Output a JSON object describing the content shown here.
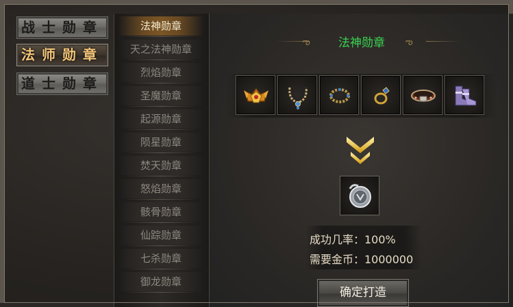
{
  "class_tabs": [
    {
      "label": "战士勋章",
      "active": false
    },
    {
      "label": "法师勋章",
      "active": true
    },
    {
      "label": "道士勋章",
      "active": false
    }
  ],
  "medal_list": [
    {
      "label": "法神勋章",
      "active": true
    },
    {
      "label": "天之法神勋章",
      "active": false
    },
    {
      "label": "烈焰勋章",
      "active": false
    },
    {
      "label": "圣魔勋章",
      "active": false
    },
    {
      "label": "起源勋章",
      "active": false
    },
    {
      "label": "陨星勋章",
      "active": false
    },
    {
      "label": "焚天勋章",
      "active": false
    },
    {
      "label": "怒焰勋章",
      "active": false
    },
    {
      "label": "骸骨勋章",
      "active": false
    },
    {
      "label": "仙踪勋章",
      "active": false
    },
    {
      "label": "七杀勋章",
      "active": false
    },
    {
      "label": "御龙勋章",
      "active": false
    }
  ],
  "panel": {
    "title": "法神勋章",
    "materials": [
      {
        "icon": "winged-crown-icon"
      },
      {
        "icon": "necklace-icon"
      },
      {
        "icon": "bead-bracelet-icon"
      },
      {
        "icon": "ring-icon"
      },
      {
        "icon": "belt-icon"
      },
      {
        "icon": "boots-icon"
      }
    ],
    "result_icon": "medal-icon",
    "success_rate": "成功几率：100%",
    "gold_required": "需要金币：1000000",
    "confirm_label": "确定打造"
  },
  "colors": {
    "title_green": "#39d451",
    "active_class_text": "#f4c67a",
    "arrow_gold": "#e6b422"
  }
}
